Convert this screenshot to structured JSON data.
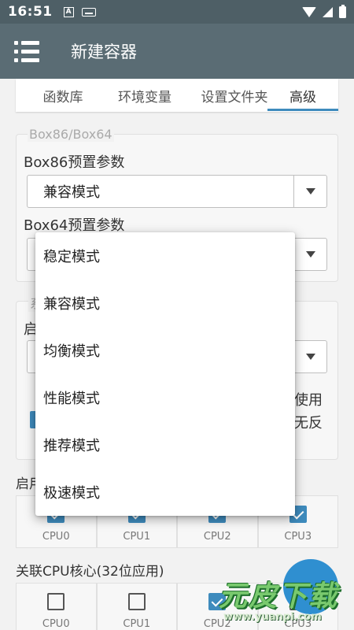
{
  "status_bar": {
    "time": "16:51",
    "notif_letter": "A"
  },
  "app_bar": {
    "title": "新建容器"
  },
  "tabs": [
    {
      "label": "函数库"
    },
    {
      "label": "环境变量"
    },
    {
      "label": "设置文件夹"
    },
    {
      "label": "高级",
      "active": true
    }
  ],
  "box_section": {
    "legend": "Box86/Box64",
    "box86_label": "Box86预置参数",
    "box86_value": "兼容模式",
    "box64_label": "Box64预置参数"
  },
  "system_section": {
    "legend_fragment": "系",
    "label_fragment": "启",
    "right_text_1": "使用",
    "right_text_2": "无反"
  },
  "cpu64": {
    "label": "启用",
    "items": [
      {
        "label": "CPU0",
        "checked": true
      },
      {
        "label": "CPU1",
        "checked": true
      },
      {
        "label": "CPU2",
        "checked": true
      },
      {
        "label": "CPU3",
        "checked": true
      }
    ]
  },
  "cpu32": {
    "label": "关联CPU核心(32位应用)",
    "items": [
      {
        "label": "CPU0",
        "checked": false
      },
      {
        "label": "CPU1",
        "checked": false
      },
      {
        "label": "CPU2",
        "checked": true
      },
      {
        "label": "CPU3",
        "checked": false
      }
    ]
  },
  "dropdown_options": [
    {
      "label": "稳定模式"
    },
    {
      "label": "兼容模式"
    },
    {
      "label": "均衡模式"
    },
    {
      "label": "性能模式"
    },
    {
      "label": "推荐模式"
    },
    {
      "label": "极速模式"
    }
  ],
  "watermark": {
    "title": "元皮下载",
    "url": "www.yuanpi.com"
  },
  "colors": {
    "app_bar": "#5a6c74",
    "status_bar": "#4e5f66",
    "accent": "#3e8bbd",
    "fab": "#2f8fd0"
  }
}
